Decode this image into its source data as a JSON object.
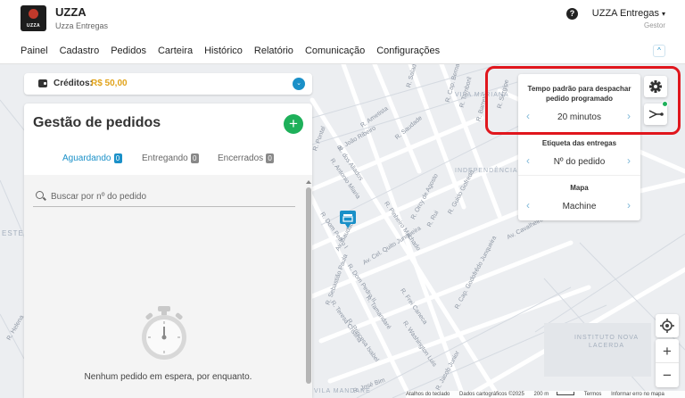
{
  "header": {
    "logo_text": "UZZA",
    "brand_title": "UZZA",
    "brand_subtitle": "Uzza Entregas",
    "help_label": "?",
    "account_name": "UZZA Entregas",
    "account_caret": "▾",
    "account_role": "Gestor"
  },
  "nav": {
    "items": [
      "Painel",
      "Cadastro",
      "Pedidos",
      "Carteira",
      "Histórico",
      "Relatório",
      "Comunicação",
      "Configurações"
    ],
    "collapse_glyph": "^"
  },
  "credits": {
    "label": "Créditos:",
    "value": "R$ 50,00",
    "toggle_glyph": "⌄"
  },
  "orders": {
    "title": "Gestão de pedidos",
    "add_label": "+",
    "tabs": [
      {
        "label": "Aguardando",
        "count": "0",
        "active": true
      },
      {
        "label": "Entregando",
        "count": "0",
        "active": false
      },
      {
        "label": "Encerrados",
        "count": "0",
        "active": false
      }
    ],
    "search_placeholder": "Buscar por nº do pedido",
    "empty_message": "Nenhum pedido em espera, por enquanto."
  },
  "settings": [
    {
      "label": "Tempo padrão para despachar pedido programado",
      "value": "20 minutos"
    },
    {
      "label": "Etiqueta das entregas",
      "value": "Nº do pedido"
    },
    {
      "label": "Mapa",
      "value": "Machine"
    }
  ],
  "map": {
    "streets": [
      "R. Ametista",
      "R. João Ribeiro",
      "R. dos Aliados",
      "R. Antonio Miaria",
      "R. Saudade",
      "Av. Cel. Quito Junqueira",
      "R. Pinheiro Machado",
      "R. Orcy de Agosto",
      "R. Rui",
      "R. Guido Gofredo",
      "Av. Cavalheiro Pessoa",
      "R. Dom Pedro II",
      "R. Tamandaré",
      "R. Teresa Cristina",
      "R. Princesa Isabel",
      "R. Frei Caneca",
      "R. Washington Luis",
      "R. Cap. Godofrêdo Junqueira",
      "R. Jacob Junior",
      "R. José Bim",
      "R. Pontal",
      "R. Sebastião Paula",
      "Av. Saudade",
      "R. Dom Pedro I",
      "R. Saladino",
      "R. Tamboril",
      "R. Barreto",
      "R. Sergipe",
      "R. Cap. Bernardino"
    ],
    "areas": [
      "VILA MARIANA",
      "INDEPENDÊNCIA",
      "ESTE",
      "INSTITUTO NOVA LACERDA",
      "VILA MANDARE",
      "R. Helena"
    ],
    "footer": [
      "Atalhos do teclado",
      "Dados cartográficos ©2025",
      "200 m",
      "Termos",
      "Informar erro no mapa"
    ],
    "zoom_in": "+",
    "zoom_out": "−"
  },
  "colors": {
    "accent": "#1a90c8",
    "add_button": "#1eb05a",
    "credits_value": "#e1a31b",
    "highlight": "#e0161d"
  }
}
